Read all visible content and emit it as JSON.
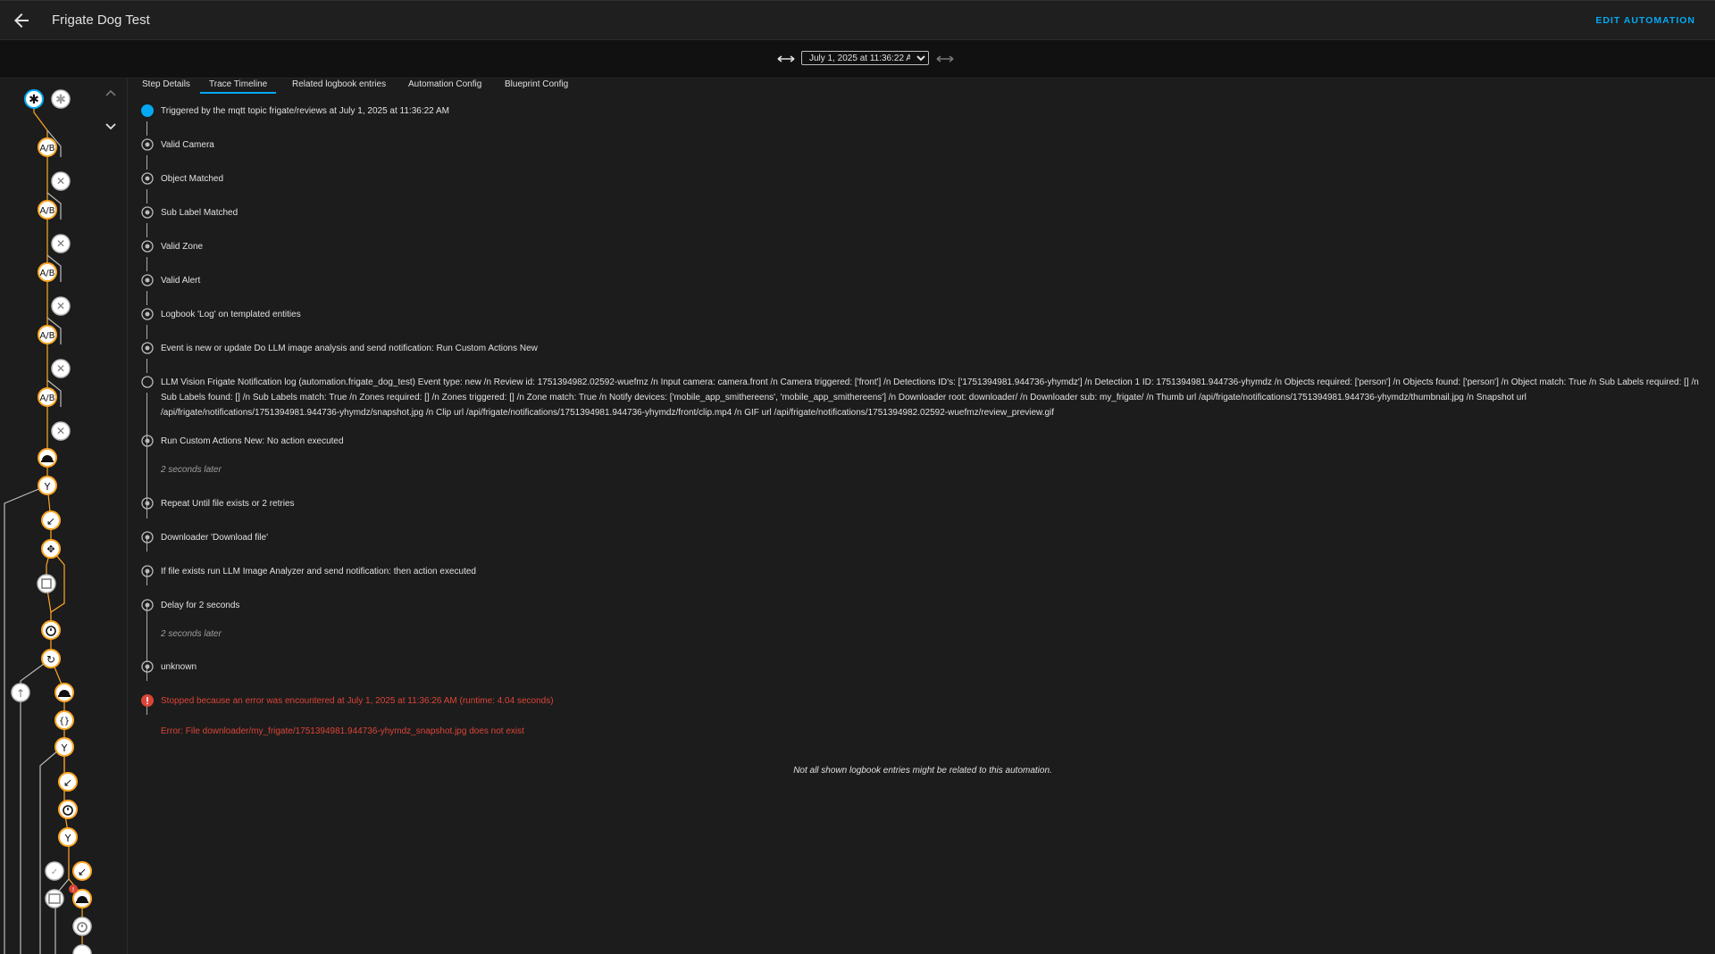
{
  "app": {
    "title": "Frigate Dog Test",
    "edit_label": "EDIT AUTOMATION",
    "accent": "#03a9f4",
    "node_color": "#ffa726",
    "error_color": "#db4437"
  },
  "trace": {
    "selected": "July 1, 2025 at 11:36:22 AM"
  },
  "tabs": [
    "Step Details",
    "Trace Timeline",
    "Related logbook entries",
    "Automation Config",
    "Blueprint Config"
  ],
  "active_tab": "Trace Timeline",
  "timeline": {
    "trigger": "Triggered by the mqtt topic frigate/reviews at July 1, 2025 at 11:36:22 AM",
    "valid_camera": "Valid Camera",
    "object_matched": "Object Matched",
    "sub_label_matched": "Sub Label Matched",
    "valid_zone": "Valid Zone",
    "valid_alert": "Valid Alert",
    "logbook": "Logbook 'Log' on templated entities",
    "event_new": "Event is new or update Do LLM image analysis and send notification: Run Custom Actions New",
    "llm_log": "LLM Vision Frigate Notification log (automation.frigate_dog_test) Event type: new /n Review id: 1751394982.02592-wuefmz /n Input camera: camera.front /n Camera triggered: ['front'] /n Detections ID's: ['1751394981.944736-yhymdz'] /n Detection 1 ID: 1751394981.944736-yhymdz /n Objects required: ['person'] /n Objects found: ['person'] /n Object match: True /n Sub Labels required: [] /n Sub Labels found: [] /n Sub Labels match: True /n Zones required: [] /n Zones triggered: [] /n Zone match: True /n Notify devices: ['mobile_app_smithereens', 'mobile_app_smithereens'] /n Downloader root: downloader/ /n Downloader sub: my_frigate/ /n Thumb url /api/frigate/notifications/1751394981.944736-yhymdz/thumbnail.jpg /n Snapshot url /api/frigate/notifications/1751394981.944736-yhymdz/snapshot.jpg /n Clip url /api/frigate/notifications/1751394981.944736-yhymdz/front/clip.mp4 /n GIF url /api/frigate/notifications/1751394982.02592-wuefmz/review_preview.gif",
    "run_custom": "Run Custom Actions New: No action executed",
    "later_1": "2 seconds later",
    "repeat": "Repeat Until file exists or 2 retries",
    "downloader": "Downloader 'Download file'",
    "if_file": "If file exists run LLM Image Analyzer and send notification: then action executed",
    "delay": "Delay for 2 seconds",
    "later_2": "2 seconds later",
    "unknown": "unknown",
    "stopped": "Stopped because an error was encountered at July 1, 2025 at 11:36:26 AM (runtime: 4.04 seconds)",
    "error": "Error: File downloader/my_frigate/1751394981.944736-yhymdz_snapshot.jpg does not exist",
    "footer": "Not all shown logbook entries might be related to this automation."
  }
}
